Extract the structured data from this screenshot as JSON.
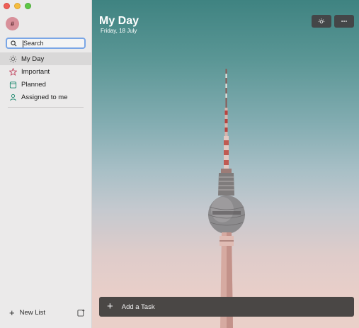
{
  "sidebar": {
    "avatar_initial": "#",
    "search_placeholder": "Search",
    "items": [
      {
        "label": "My Day",
        "icon": "sun-icon"
      },
      {
        "label": "Important",
        "icon": "star-icon"
      },
      {
        "label": "Planned",
        "icon": "calendar-icon"
      },
      {
        "label": "Assigned to me",
        "icon": "person-icon"
      }
    ],
    "new_list_label": "New List"
  },
  "main": {
    "title": "My Day",
    "date": "Friday, 18 July",
    "add_task_label": "Add a Task"
  },
  "colors": {
    "accent_blue": "#7aa6e6",
    "important_star": "#c0425c",
    "planned_calendar": "#1f8a70",
    "assigned_person": "#1f8a70",
    "avatar_bg": "#d8909a"
  }
}
